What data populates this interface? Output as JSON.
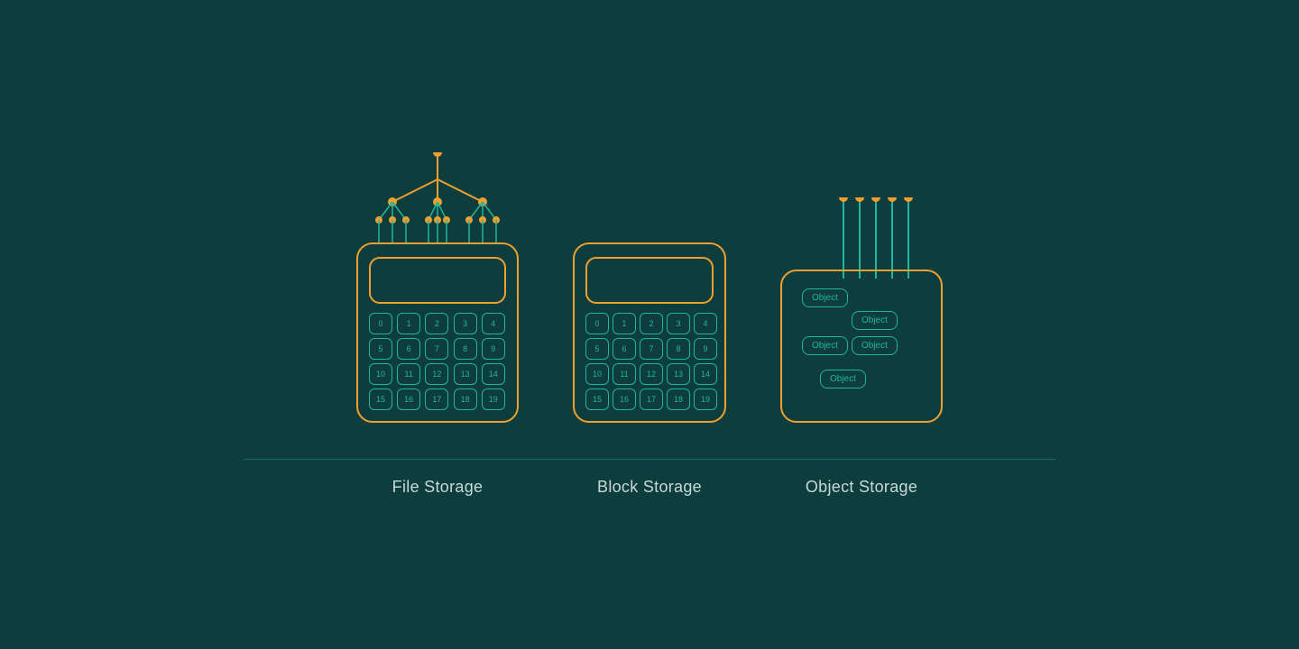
{
  "page": {
    "background_color": "#0d3d3d",
    "accent_color": "#f0a030",
    "teal_color": "#20b5a0"
  },
  "labels": {
    "file_storage": "File Storage",
    "block_storage": "Block Storage",
    "object_storage": "Object Storage"
  },
  "file_storage": {
    "numbers": [
      "0",
      "1",
      "2",
      "3",
      "4",
      "5",
      "6",
      "7",
      "8",
      "9",
      "10",
      "11",
      "12",
      "13",
      "14",
      "15",
      "16",
      "17",
      "18",
      "19"
    ]
  },
  "block_storage": {
    "numbers": [
      "0",
      "1",
      "2",
      "3",
      "4",
      "5",
      "6",
      "7",
      "8",
      "9",
      "10",
      "11",
      "12",
      "13",
      "14",
      "15",
      "16",
      "17",
      "18",
      "19"
    ]
  },
  "object_storage": {
    "items": [
      "Object",
      "Object",
      "Object",
      "Object",
      "Object"
    ]
  }
}
